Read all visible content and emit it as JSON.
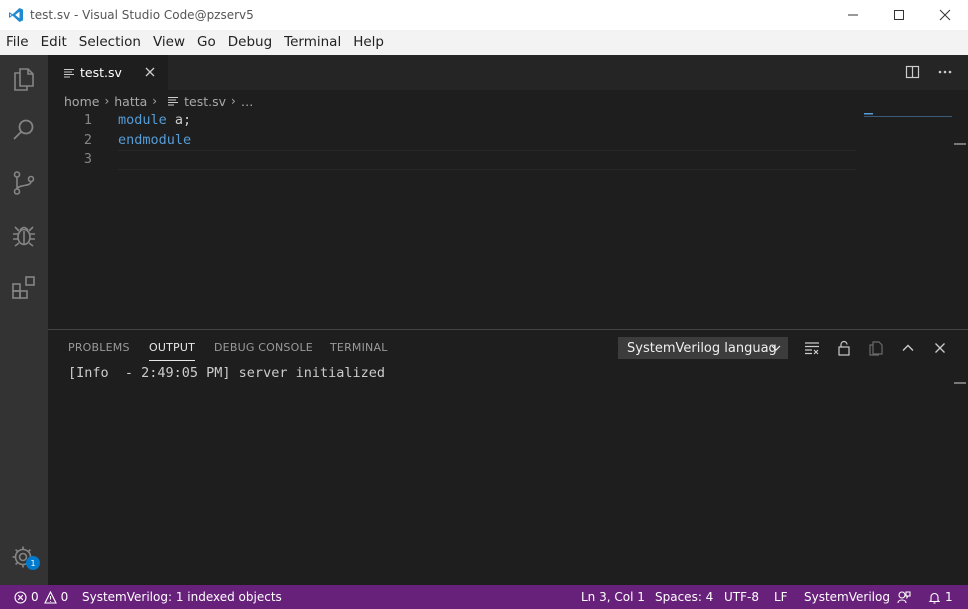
{
  "window": {
    "title": "test.sv - Visual Studio Code@pzserv5"
  },
  "menu": [
    "File",
    "Edit",
    "Selection",
    "View",
    "Go",
    "Debug",
    "Terminal",
    "Help"
  ],
  "activity": {
    "settings_badge": "1"
  },
  "tab": {
    "label": "test.sv"
  },
  "breadcrumb": {
    "seg1": "home",
    "seg2": "hatta",
    "file": "test.sv",
    "more": "…"
  },
  "editor": {
    "lines": [
      {
        "num": "1",
        "kw": "module",
        "rest": " a;"
      },
      {
        "num": "2",
        "kw": "endmodule",
        "rest": ""
      },
      {
        "num": "3",
        "kw": "",
        "rest": ""
      }
    ]
  },
  "panel": {
    "tabs": [
      "PROBLEMS",
      "OUTPUT",
      "DEBUG CONSOLE",
      "TERMINAL"
    ],
    "active_tab": "OUTPUT",
    "channel": "SystemVerilog languag",
    "output": "[Info  - 2:49:05 PM] server initialized"
  },
  "status": {
    "errors": "0",
    "warnings": "0",
    "indexed": "SystemVerilog: 1 indexed objects",
    "position": "Ln 3, Col 1",
    "spaces": "Spaces: 4",
    "encoding": "UTF-8",
    "eol": "LF",
    "language": "SystemVerilog",
    "notifications": "1"
  },
  "colors": {
    "statusbar": "#68217a",
    "keyword": "#569cd6",
    "activitybar": "#333333",
    "accent": "#007acc"
  }
}
